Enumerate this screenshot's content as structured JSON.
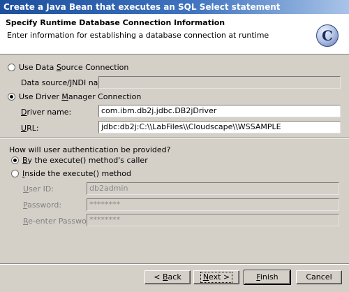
{
  "window": {
    "title": "Create a Java Bean that executes an SQL Select statement"
  },
  "header": {
    "title": "Specify Runtime Database Connection Information",
    "description": "Enter information for establishing a database connection at runtime",
    "logo_letter": "C"
  },
  "connection": {
    "datasource_option": "Use Data Source Connection",
    "datasource_jndi_label": "Data source/JNDI name:",
    "datasource_jndi_value": "",
    "driver_option": "Use Driver Manager Connection",
    "driver_name_label": "Driver name:",
    "driver_name_value": "com.ibm.db2j.jdbc.DB2jDriver",
    "url_label": "URL:",
    "url_value": "jdbc:db2j:C:\\\\LabFiles\\\\Cloudscape\\\\WSSAMPLE",
    "selected": "driver"
  },
  "auth": {
    "question": "How will user authentication be provided?",
    "caller_option": "By the execute() method's caller",
    "inside_option": "Inside the execute() method",
    "userid_label": "User ID:",
    "userid_value": "db2admin",
    "password_label": "Password:",
    "password_value": "********",
    "reenter_label": "Re-enter Password:",
    "reenter_value": "********",
    "selected": "caller"
  },
  "buttons": {
    "back": "< Back",
    "next": "Next >",
    "finish": "Finish",
    "cancel": "Cancel"
  }
}
